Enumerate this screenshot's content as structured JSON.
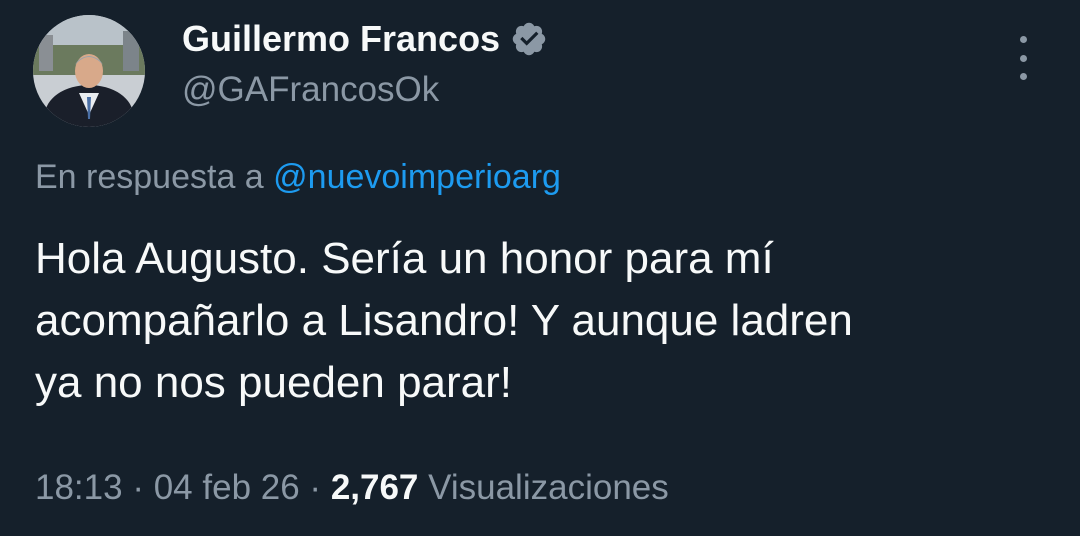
{
  "author": {
    "display_name": "Guillermo Francos",
    "handle": "@GAFrancosOk",
    "verified_icon": "verified-badge-icon",
    "avatar_icon": "profile-photo"
  },
  "menu": {
    "icon": "more-vertical-icon"
  },
  "reply": {
    "prefix": "En respuesta a",
    "to_handle": "@nuevoimperioarg"
  },
  "tweet": {
    "lines": [
      "Hola Augusto. Sería un honor para mí",
      "acompañarlo a Lisandro! Y aunque ladren",
      "ya no nos pueden parar!"
    ]
  },
  "meta": {
    "time": "18:13",
    "separator": "·",
    "date": "04 feb 26",
    "views_count": "2,767",
    "views_label": "Visualizaciones"
  },
  "colors": {
    "background": "#15202b",
    "text_primary": "#f7f9f9",
    "text_secondary": "#8b98a5",
    "link": "#1d9bf0"
  }
}
